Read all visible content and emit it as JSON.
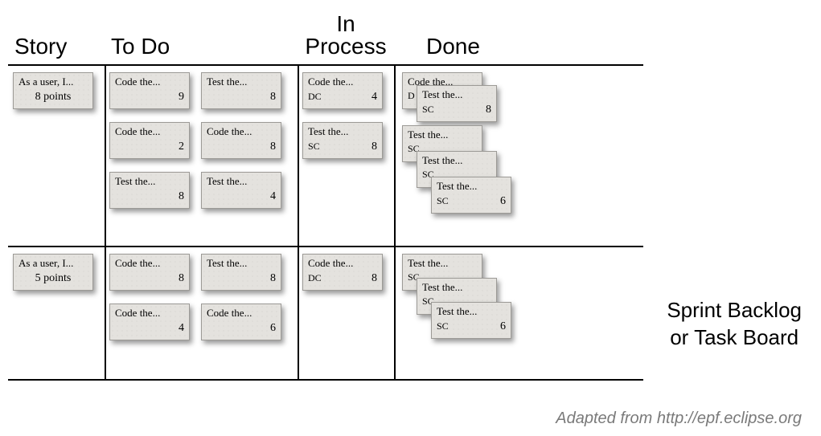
{
  "columns": [
    "Story",
    "To Do",
    "In Process",
    "Done"
  ],
  "side_caption_line1": "Sprint Backlog",
  "side_caption_line2": "or Task Board",
  "attribution": "Adapted from http://epf.eclipse.org",
  "rows": [
    {
      "story": {
        "title": "As a user, I...",
        "points_label": "8 points"
      },
      "todo": [
        {
          "title": "Code the...",
          "num": "9"
        },
        {
          "title": "Test the...",
          "num": "8"
        },
        {
          "title": "Code the...",
          "num": "2"
        },
        {
          "title": "Code the...",
          "num": "8"
        },
        {
          "title": "Test the...",
          "num": "8"
        },
        {
          "title": "Test the...",
          "num": "4"
        }
      ],
      "in_process": [
        {
          "title": "Code the...",
          "owner": "DC",
          "num": "4"
        },
        {
          "title": "Test the...",
          "owner": "SC",
          "num": "8"
        }
      ],
      "done": [
        {
          "title": "Code the...",
          "owner": "D",
          "num": ""
        },
        {
          "title": "Test the...",
          "owner": "SC",
          "num": "8"
        },
        {
          "title": "Test the...",
          "owner": "SC",
          "num": ""
        },
        {
          "title": "Test the...",
          "owner": "SC",
          "num": ""
        },
        {
          "title": "Test the...",
          "owner": "SC",
          "num": "6"
        }
      ]
    },
    {
      "story": {
        "title": "As a user, I...",
        "points_label": "5 points"
      },
      "todo": [
        {
          "title": "Code the...",
          "num": "8"
        },
        {
          "title": "Test the...",
          "num": "8"
        },
        {
          "title": "Code the...",
          "num": "4"
        },
        {
          "title": "Code the...",
          "num": "6"
        }
      ],
      "in_process": [
        {
          "title": "Code the...",
          "owner": "DC",
          "num": "8"
        }
      ],
      "done": [
        {
          "title": "Test the...",
          "owner": "SC",
          "num": ""
        },
        {
          "title": "Test the...",
          "owner": "SC",
          "num": ""
        },
        {
          "title": "Test the...",
          "owner": "SC",
          "num": "6"
        }
      ]
    }
  ]
}
